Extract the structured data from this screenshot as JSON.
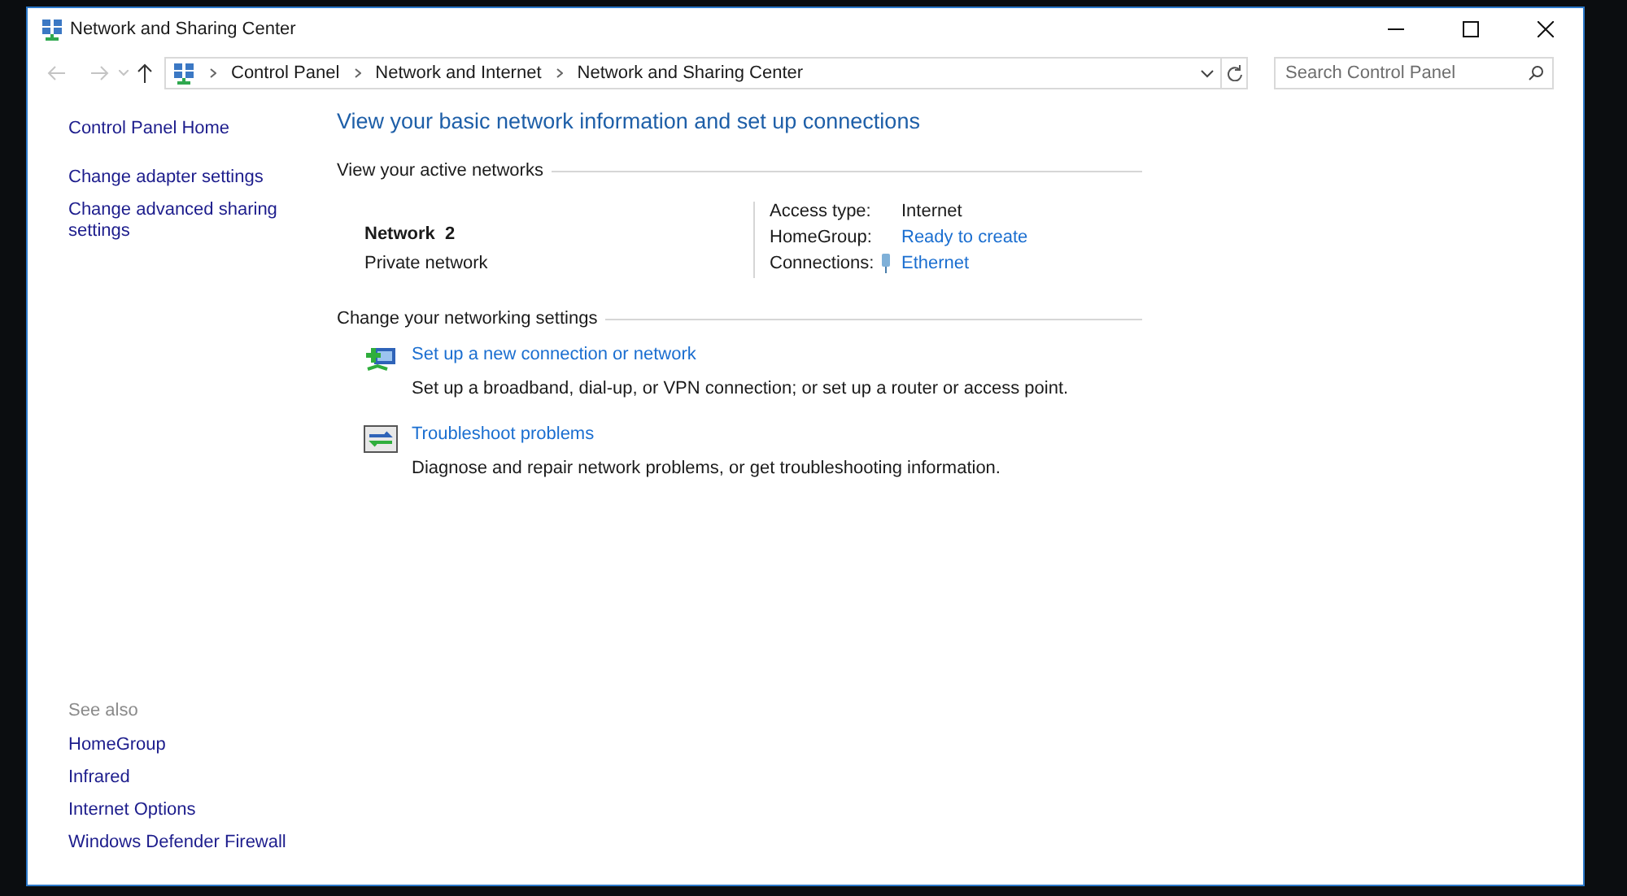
{
  "window": {
    "title": "Network and Sharing Center"
  },
  "address_bar": {
    "breadcrumb": [
      "Control Panel",
      "Network and Internet",
      "Network and Sharing Center"
    ]
  },
  "search": {
    "placeholder": "Search Control Panel"
  },
  "sidebar": {
    "links": [
      "Control Panel Home",
      "Change adapter settings",
      "Change advanced sharing settings"
    ]
  },
  "main": {
    "heading": "View your basic network information and set up connections",
    "active_networks": {
      "section_title": "View your active networks",
      "network_name": "Network  2",
      "network_category": "Private network",
      "properties": [
        {
          "label": "Access type:",
          "value": "Internet",
          "kind": "text"
        },
        {
          "label": "HomeGroup:",
          "value": "Ready to create",
          "kind": "link"
        },
        {
          "label": "Connections:",
          "value": "Ethernet",
          "kind": "ethernet_link"
        }
      ]
    },
    "settings": {
      "section_title": "Change your networking settings",
      "tasks": [
        {
          "title": "Set up a new connection or network",
          "description": "Set up a broadband, dial-up, or VPN connection; or set up a router or access point.",
          "kind": "new_connection"
        },
        {
          "title": "Troubleshoot problems",
          "description": "Diagnose and repair network problems, or get troubleshooting information.",
          "kind": "troubleshoot"
        }
      ]
    }
  },
  "see_also": {
    "title": "See also",
    "links": [
      "HomeGroup",
      "Infrared",
      "Internet Options",
      "Windows Defender Firewall"
    ]
  }
}
